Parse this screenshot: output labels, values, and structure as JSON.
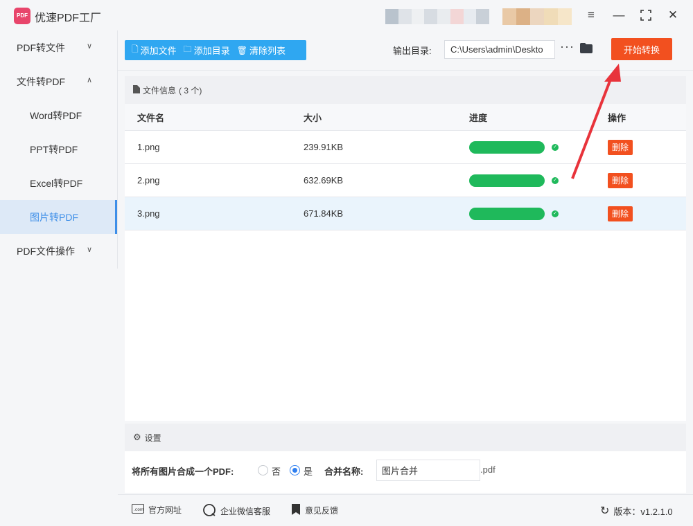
{
  "app": {
    "title": "优速PDF工厂",
    "logo_text": "PDF"
  },
  "window": {
    "menu_icon": "hamburger-menu-icon",
    "minimize_icon": "minimize-icon",
    "maximize_icon": "maximize-icon",
    "close_icon": "close-icon"
  },
  "sidebar": {
    "items": [
      {
        "label": "PDF转文件",
        "expandable": true,
        "expanded": false
      },
      {
        "label": "文件转PDF",
        "expandable": true,
        "expanded": true
      },
      {
        "label": "Word转PDF",
        "sub": true
      },
      {
        "label": "PPT转PDF",
        "sub": true
      },
      {
        "label": "Excel转PDF",
        "sub": true
      },
      {
        "label": "图片转PDF",
        "sub": true,
        "active": true
      },
      {
        "label": "PDF文件操作",
        "expandable": true,
        "expanded": false
      }
    ]
  },
  "toolbar": {
    "add_file": "添加文件",
    "add_folder": "添加目录",
    "clear_list": "清除列表",
    "output_label": "输出目录:",
    "output_path": "C:\\Users\\admin\\Deskto",
    "more": "···",
    "start": "开始转换"
  },
  "file_panel": {
    "header": "文件信息",
    "count": "( 3 个)",
    "columns": [
      "文件名",
      "大小",
      "进度",
      "操作"
    ],
    "rows": [
      {
        "name": "1.png",
        "size": "239.91KB",
        "progress": 1.0,
        "action": "删除"
      },
      {
        "name": "2.png",
        "size": "632.69KB",
        "progress": 1.0,
        "action": "删除"
      },
      {
        "name": "3.png",
        "size": "671.84KB",
        "progress": 1.0,
        "action": "删除",
        "selected": true
      }
    ]
  },
  "settings": {
    "header": "设置",
    "merge_label": "将所有图片合成一个PDF:",
    "option_no": "否",
    "option_yes": "是",
    "selected": "是",
    "merge_name_label": "合并名称:",
    "merge_name_value": "图片合并",
    "extension": ".pdf"
  },
  "footer": {
    "website": "官方网址",
    "wechat": "企业微信客服",
    "feedback": "意见反馈",
    "version": "版本：v1.2.1.0"
  },
  "colors": {
    "accent_blue": "#2fa7f1",
    "start_orange": "#f2501f",
    "progress_green": "#1fb95b",
    "annotation_red": "#e8333b"
  }
}
